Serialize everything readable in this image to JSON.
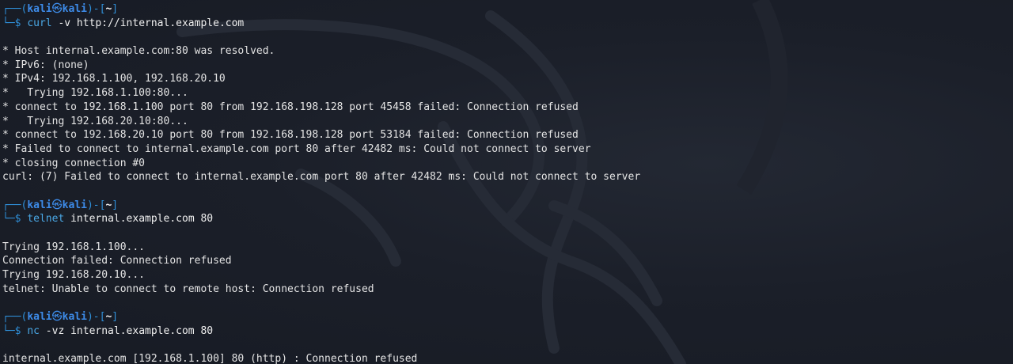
{
  "prompt": {
    "user": "kali",
    "separator_icon": "㉿",
    "host": "kali",
    "cwd": "~",
    "symbol": "$"
  },
  "blocks": [
    {
      "command": {
        "name": "curl",
        "args": " -v http://internal.example.com"
      },
      "output": [
        "* Host internal.example.com:80 was resolved.",
        "* IPv6: (none)",
        "* IPv4: 192.168.1.100, 192.168.20.10",
        "*   Trying 192.168.1.100:80...",
        "* connect to 192.168.1.100 port 80 from 192.168.198.128 port 45458 failed: Connection refused",
        "*   Trying 192.168.20.10:80...",
        "* connect to 192.168.20.10 port 80 from 192.168.198.128 port 53184 failed: Connection refused",
        "* Failed to connect to internal.example.com port 80 after 42482 ms: Could not connect to server",
        "* closing connection #0",
        "curl: (7) Failed to connect to internal.example.com port 80 after 42482 ms: Could not connect to server"
      ]
    },
    {
      "command": {
        "name": "telnet",
        "args": " internal.example.com 80"
      },
      "output": [
        "Trying 192.168.1.100...",
        "Connection failed: Connection refused",
        "Trying 192.168.20.10...",
        "telnet: Unable to connect to remote host: Connection refused"
      ]
    },
    {
      "command": {
        "name": "nc",
        "args": " -vz internal.example.com 80"
      },
      "output": [
        "internal.example.com [192.168.1.100] 80 (http) : Connection refused"
      ]
    }
  ]
}
